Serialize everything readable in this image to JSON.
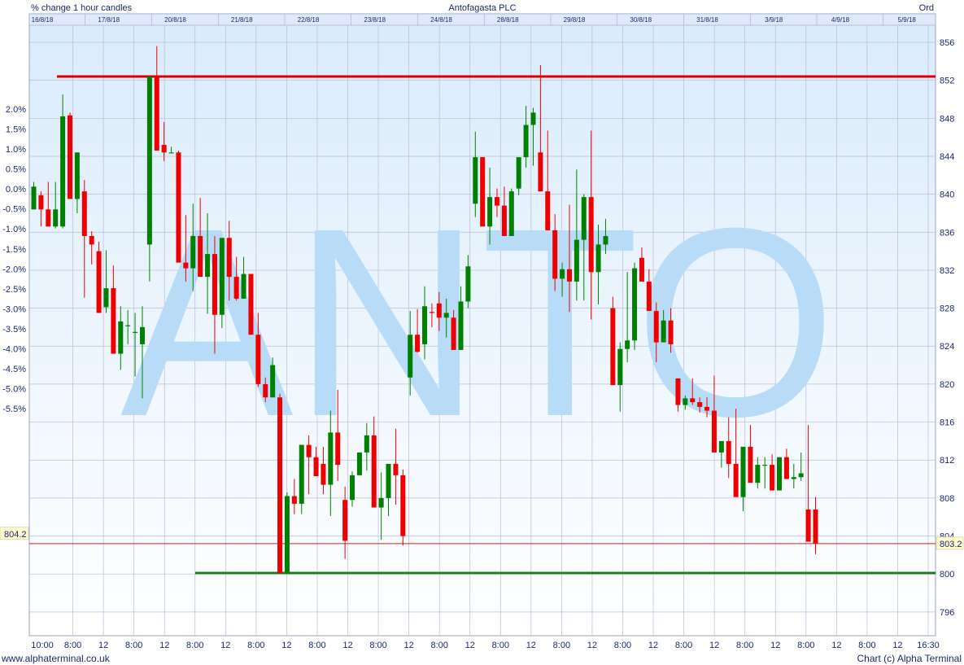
{
  "chart_data": {
    "type": "candlestick",
    "title": "Antofagasta PLC",
    "left_title": "% change 1 hour candles",
    "right_title": "Ord",
    "watermark": "ANTO",
    "footer_left": "www.alphaterminal.co.uk",
    "footer_right": "Chart (c) Alpha Terminal",
    "y_left_ticks": [
      "2.0%",
      "1.5%",
      "1.0%",
      "0.5%",
      "0.0%",
      "-0.5%",
      "-1.0%",
      "-1.5%",
      "-2.0%",
      "-2.5%",
      "-3.0%",
      "-3.5%",
      "-4.0%",
      "-4.5%",
      "-5.0%",
      "-5.5%"
    ],
    "y_right_ticks": [
      "856",
      "852",
      "848",
      "844",
      "840",
      "836",
      "832",
      "828",
      "824",
      "820",
      "816",
      "812",
      "808",
      "804",
      "800",
      "796"
    ],
    "ylim_price": [
      793.5,
      857.8
    ],
    "x_time_labels": [
      "10:00",
      "8:00",
      "12",
      "8:00",
      "12",
      "8:00",
      "12",
      "8:00",
      "12",
      "8:00",
      "12",
      "8:00",
      "12",
      "8:00",
      "12",
      "8:00",
      "12",
      "8:00",
      "12",
      "8:00",
      "12",
      "8:00",
      "12",
      "8:00",
      "12",
      "8:00",
      "12",
      "8:00",
      "12",
      "16:30"
    ],
    "date_labels": [
      "16/8/18",
      "17/8/18",
      "20/8/18",
      "21/8/18",
      "22/8/18",
      "23/8/18",
      "24/8/18",
      "28/8/18",
      "29/8/18",
      "30/8/18",
      "31/8/18",
      "3/9/18",
      "4/9/18",
      "5/9/18"
    ],
    "last_price_label": "803.2",
    "left_marker_label": "804.2",
    "last_price": 803.2,
    "resistance_level": 852.4,
    "support_level": 800.1,
    "colors": {
      "up": "#008000",
      "down": "#ee0000",
      "resistance": "#dd0000",
      "support": "#1e7a1e",
      "watermark": "#b8dcf8",
      "grid": "#b8bcd8"
    },
    "candles": [
      [
        838.4,
        841.3,
        838.4,
        840.8
      ],
      [
        839.9,
        840.3,
        836.6,
        838.4
      ],
      [
        838.4,
        841.3,
        836.6,
        836.6
      ],
      [
        836.6,
        841.3,
        836.4,
        838.4
      ],
      [
        836.6,
        850.5,
        836.4,
        848.2
      ],
      [
        848.3,
        848.6,
        839.5,
        839.5
      ],
      [
        839.5,
        844.4,
        838.0,
        844.4
      ],
      [
        840.3,
        841.5,
        829.1,
        835.6
      ],
      [
        835.6,
        836.1,
        832.6,
        834.7
      ],
      [
        834.0,
        835.0,
        827.5,
        827.5
      ],
      [
        828.1,
        834.1,
        827.5,
        830.1
      ],
      [
        830.1,
        832.5,
        823.2,
        823.2
      ],
      [
        823.2,
        828.2,
        821.5,
        826.6
      ],
      [
        826.2,
        827.8,
        824.2,
        826.2
      ],
      [
        825.5,
        827.5,
        820.8,
        825.5
      ],
      [
        824.2,
        828.2,
        818.5,
        826.0
      ],
      [
        834.7,
        852.4,
        830.8,
        852.4
      ],
      [
        852.4,
        855.6,
        845.2,
        844.6
      ],
      [
        845.2,
        847.6,
        843.5,
        844.4
      ],
      [
        844.4,
        845.0,
        844.3,
        844.4
      ],
      [
        844.4,
        844.6,
        837.8,
        832.8
      ],
      [
        832.8,
        837.8,
        830.8,
        832.2
      ],
      [
        832.2,
        839.0,
        829.8,
        835.6
      ],
      [
        835.6,
        839.6,
        834.7,
        831.3
      ],
      [
        831.3,
        838.0,
        827.4,
        833.7
      ],
      [
        833.7,
        835.6,
        823.2,
        827.3
      ],
      [
        827.3,
        834.0,
        825.9,
        835.4
      ],
      [
        835.4,
        837.2,
        828.8,
        831.3
      ],
      [
        831.3,
        833.4,
        828.8,
        829.0
      ],
      [
        829.0,
        833.4,
        829.0,
        831.6
      ],
      [
        831.6,
        831.6,
        825.3,
        825.2
      ],
      [
        825.2,
        827.5,
        819.7,
        820.0
      ],
      [
        820.0,
        820.7,
        818.1,
        818.6
      ],
      [
        818.6,
        822.8,
        818.6,
        822.0
      ],
      [
        818.6,
        819.0,
        800.1,
        800.1
      ],
      [
        800.1,
        808.6,
        800.0,
        808.2
      ],
      [
        808.2,
        810.0,
        806.3,
        807.4
      ],
      [
        807.4,
        813.6,
        806.3,
        813.6
      ],
      [
        813.6,
        814.6,
        808.4,
        812.3
      ],
      [
        812.3,
        813.4,
        811.0,
        810.3
      ],
      [
        811.6,
        813.4,
        808.4,
        809.4
      ],
      [
        809.4,
        817.2,
        806.1,
        814.9
      ],
      [
        814.9,
        819.4,
        809.8,
        811.5
      ],
      [
        807.8,
        809.2,
        801.6,
        803.5
      ],
      [
        807.8,
        810.8,
        807.1,
        810.4
      ],
      [
        810.4,
        812.8,
        810.4,
        812.8
      ],
      [
        812.8,
        815.9,
        810.9,
        814.6
      ],
      [
        814.6,
        816.6,
        808.4,
        807.0
      ],
      [
        807.0,
        810.7,
        803.6,
        808.0
      ],
      [
        808.0,
        810.8,
        806.1,
        811.6
      ],
      [
        811.6,
        815.3,
        807.3,
        810.4
      ],
      [
        810.4,
        811.0,
        803.0,
        804.0
      ],
      [
        820.7,
        827.7,
        818.8,
        825.2
      ],
      [
        825.2,
        827.9,
        823.3,
        823.4
      ],
      [
        824.2,
        830.3,
        822.6,
        828.2
      ],
      [
        827.6,
        828.5,
        826.0,
        827.5
      ],
      [
        828.5,
        829.7,
        825.6,
        827.0
      ],
      [
        827.0,
        829.0,
        824.9,
        827.5
      ],
      [
        827.0,
        827.8,
        823.7,
        823.6
      ],
      [
        823.6,
        830.3,
        823.6,
        828.7
      ],
      [
        828.7,
        833.6,
        828.0,
        832.4
      ],
      [
        839.0,
        846.6,
        837.6,
        843.9
      ],
      [
        843.9,
        843.9,
        836.8,
        836.6
      ],
      [
        836.6,
        842.8,
        834.7,
        839.7
      ],
      [
        839.7,
        840.6,
        837.6,
        838.8
      ],
      [
        838.8,
        840.8,
        835.6,
        835.6
      ],
      [
        835.6,
        840.6,
        835.6,
        840.3
      ],
      [
        840.6,
        843.6,
        839.9,
        843.9
      ],
      [
        843.9,
        849.3,
        842.8,
        847.3
      ],
      [
        847.3,
        849.1,
        843.0,
        848.6
      ],
      [
        844.4,
        853.6,
        840.3,
        840.3
      ],
      [
        840.3,
        846.7,
        836.2,
        836.2
      ],
      [
        836.2,
        837.9,
        829.8,
        831.1
      ],
      [
        831.1,
        832.8,
        829.2,
        832.1
      ],
      [
        832.1,
        838.9,
        827.6,
        830.8
      ],
      [
        830.8,
        842.6,
        828.8,
        835.2
      ],
      [
        835.2,
        840.0,
        828.8,
        839.7
      ],
      [
        839.7,
        846.7,
        826.8,
        831.8
      ],
      [
        831.8,
        836.8,
        828.4,
        834.7
      ],
      [
        834.7,
        837.4,
        833.7,
        835.6
      ],
      [
        828.0,
        829.2,
        819.9,
        819.9
      ],
      [
        819.9,
        824.4,
        817.1,
        823.7
      ],
      [
        823.7,
        831.8,
        822.3,
        824.6
      ],
      [
        824.6,
        832.8,
        823.6,
        832.2
      ],
      [
        833.3,
        834.4,
        830.8,
        830.8
      ],
      [
        830.8,
        832.1,
        828.1,
        827.7
      ],
      [
        827.7,
        828.6,
        822.3,
        824.4
      ],
      [
        824.4,
        827.8,
        824.4,
        826.7
      ],
      [
        826.7,
        828.0,
        823.3,
        824.2
      ],
      [
        820.6,
        820.6,
        817.1,
        817.8
      ],
      [
        817.8,
        818.8,
        817.3,
        818.5
      ],
      [
        818.5,
        820.6,
        817.8,
        818.1
      ],
      [
        818.1,
        818.6,
        817.0,
        817.6
      ],
      [
        817.6,
        818.6,
        816.5,
        817.2
      ],
      [
        817.2,
        820.9,
        816.3,
        812.8
      ],
      [
        812.8,
        813.4,
        811.2,
        814.0
      ],
      [
        814.0,
        816.5,
        810.1,
        811.6
      ],
      [
        811.6,
        817.4,
        810.4,
        808.1
      ],
      [
        808.1,
        813.4,
        806.6,
        813.4
      ],
      [
        813.4,
        815.7,
        810.4,
        809.6
      ],
      [
        809.6,
        812.3,
        809.0,
        811.5
      ],
      [
        811.5,
        812.3,
        809.0,
        811.5
      ],
      [
        811.5,
        812.6,
        808.8,
        808.8
      ],
      [
        808.8,
        812.3,
        809.2,
        812.3
      ],
      [
        812.3,
        813.2,
        810.1,
        810.0
      ],
      [
        810.0,
        811.6,
        809.0,
        810.2
      ],
      [
        810.2,
        812.8,
        809.8,
        810.6
      ],
      [
        806.8,
        815.7,
        806.8,
        803.4
      ],
      [
        806.8,
        808.1,
        802.1,
        803.2
      ]
    ]
  }
}
